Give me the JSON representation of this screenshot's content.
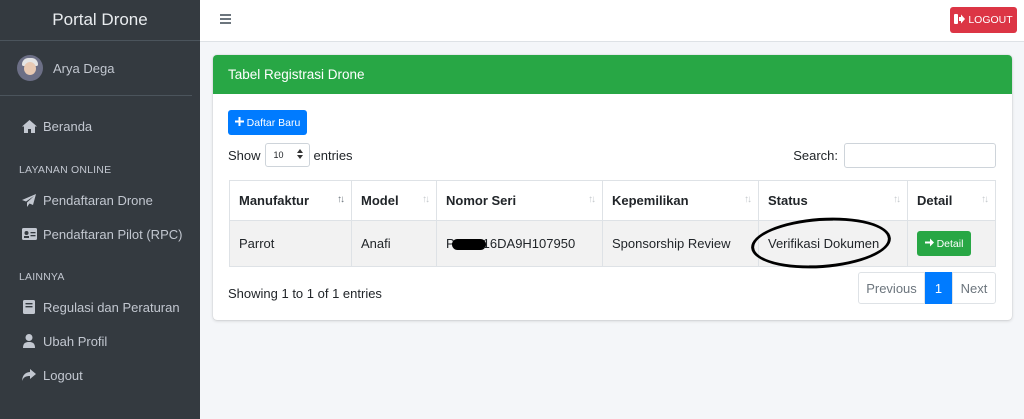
{
  "sidebar": {
    "brand": "Portal Drone",
    "user_name": "Arya Dega",
    "items_main": [
      {
        "label": "Beranda",
        "icon": "home-icon"
      }
    ],
    "section_online": "LAYANAN ONLINE",
    "items_online": [
      {
        "label": "Pendaftaran Drone",
        "icon": "paper-plane-icon"
      },
      {
        "label": "Pendaftaran Pilot (RPC)",
        "icon": "id-card-icon"
      }
    ],
    "section_other": "LAINNYA",
    "items_other": [
      {
        "label": "Regulasi dan Peraturan",
        "icon": "book-icon"
      },
      {
        "label": "Ubah Profil",
        "icon": "user-icon"
      },
      {
        "label": "Logout",
        "icon": "share-icon"
      }
    ]
  },
  "topbar": {
    "logout_label": "LOGOUT"
  },
  "card": {
    "title": "Tabel Registrasi Drone",
    "add_button": "Daftar Baru",
    "show_label": "Show",
    "entries_value": "10",
    "entries_label": "entries",
    "search_label": "Search:",
    "search_value": ""
  },
  "table": {
    "columns": [
      "Manufaktur",
      "Model",
      "Nomor Seri",
      "Kepemilikan",
      "Status",
      "Detail"
    ],
    "rows": [
      {
        "manufaktur": "Parrot",
        "model": "Anafi",
        "nomor_seri_prefix": "P",
        "nomor_seri_suffix": "16DA9H107950",
        "kepemilikan": "Sponsorship Review",
        "status": "Verifikasi Dokumen",
        "detail_label": "Detail"
      }
    ]
  },
  "footer": {
    "info": "Showing 1 to 1 of 1 entries",
    "prev": "Previous",
    "page": "1",
    "next": "Next"
  },
  "colors": {
    "sidebar_bg": "#343a40",
    "header_green": "#28a745",
    "primary_blue": "#007bff",
    "danger_red": "#dc3545"
  }
}
